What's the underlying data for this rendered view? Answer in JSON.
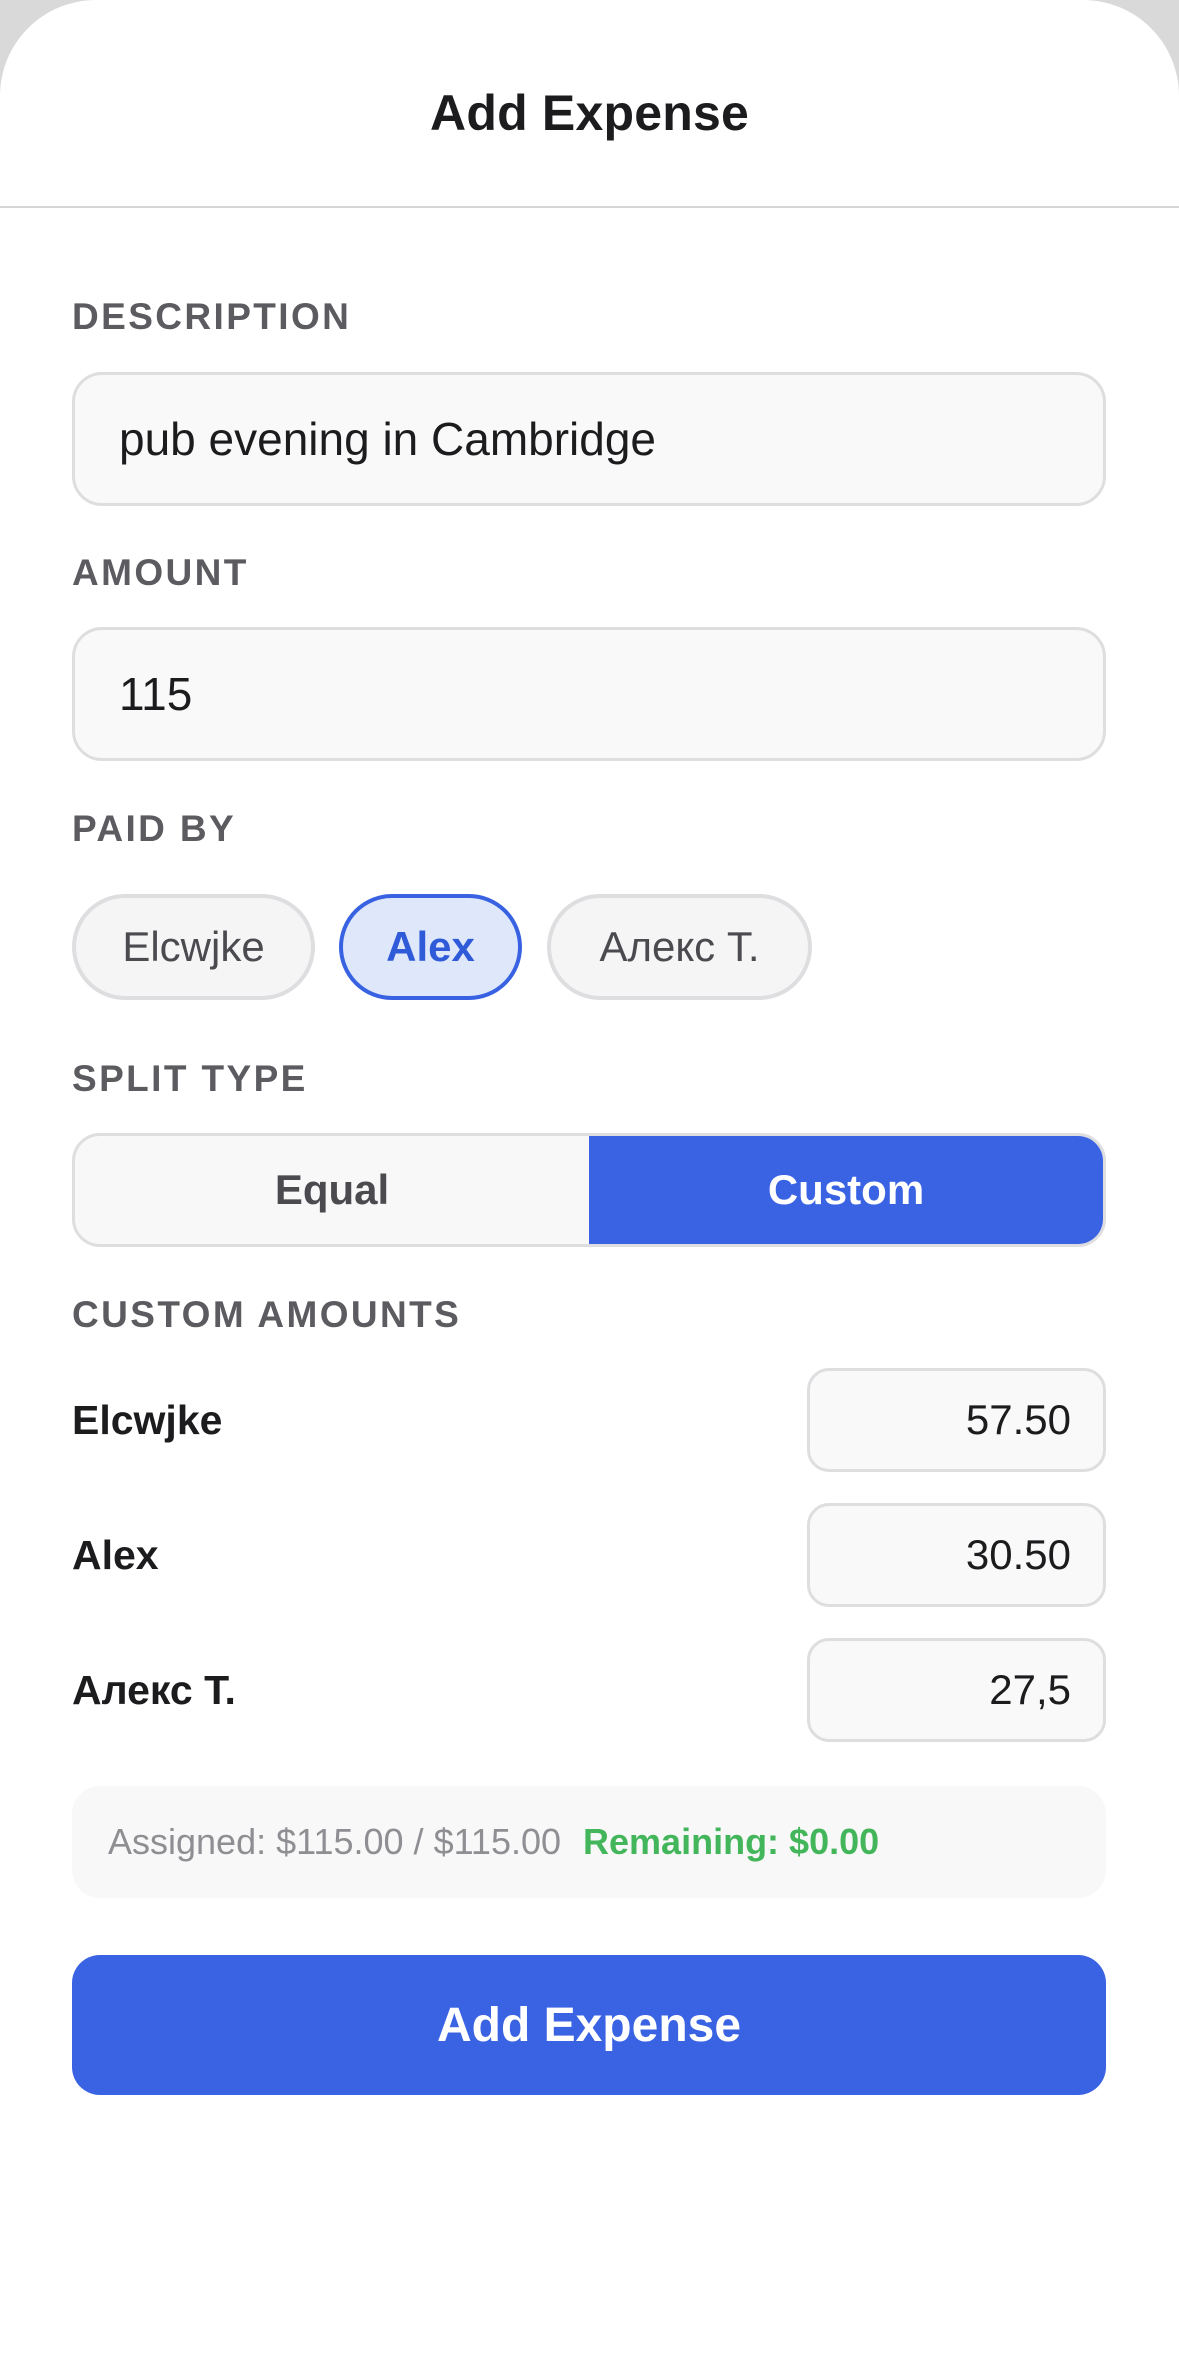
{
  "header": {
    "title": "Add Expense"
  },
  "description": {
    "label": "DESCRIPTION",
    "value": "pub evening in Cambridge"
  },
  "amount": {
    "label": "AMOUNT",
    "value": "115"
  },
  "paid_by": {
    "label": "PAID BY",
    "options": [
      "Elcwjke",
      "Alex",
      "Алекс Т."
    ],
    "selected": "Alex"
  },
  "split_type": {
    "label": "SPLIT TYPE",
    "options": [
      "Equal",
      "Custom"
    ],
    "selected": "Custom"
  },
  "custom_amounts": {
    "label": "CUSTOM AMOUNTS",
    "rows": [
      {
        "name": "Elcwjke",
        "value": "57.50"
      },
      {
        "name": "Alex",
        "value": "30.50"
      },
      {
        "name": "Алекс Т.",
        "value": "27,5"
      }
    ]
  },
  "summary": {
    "assigned": "Assigned: $115.00 / $115.00",
    "remaining": "Remaining: $0.00"
  },
  "submit": {
    "label": "Add Expense"
  },
  "colors": {
    "accent": "#3a63e4",
    "selected_chip_bg": "#dfe8fb",
    "remaining_green": "#43b55a",
    "field_border": "#dedee0"
  }
}
